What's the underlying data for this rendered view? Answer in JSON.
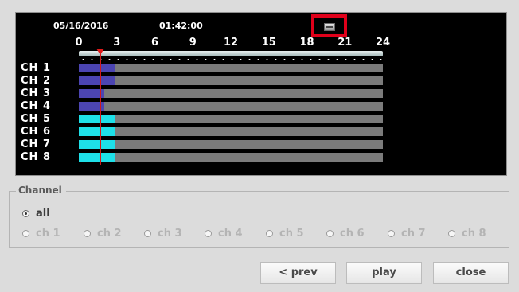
{
  "timeline": {
    "date": "05/16/2016",
    "time": "01:42:00",
    "hour_ticks": [
      "0",
      "3",
      "6",
      "9",
      "12",
      "15",
      "18",
      "21",
      "24"
    ],
    "hours_total": 24,
    "cursor_hour": 1.7,
    "menu_icon": "menu-icon",
    "channels": [
      {
        "label": "CH 1",
        "recorded_until_hour": 2.8,
        "color": "#4c45b2"
      },
      {
        "label": "CH 2",
        "recorded_until_hour": 2.8,
        "color": "#4c45b2"
      },
      {
        "label": "CH 3",
        "recorded_until_hour": 2.0,
        "color": "#4c45b2"
      },
      {
        "label": "CH 4",
        "recorded_until_hour": 2.0,
        "color": "#4c45b2"
      },
      {
        "label": "CH 5",
        "recorded_until_hour": 2.8,
        "color": "#1ee0e8"
      },
      {
        "label": "CH 6",
        "recorded_until_hour": 2.8,
        "color": "#1ee0e8"
      },
      {
        "label": "CH 7",
        "recorded_until_hour": 2.8,
        "color": "#1ee0e8"
      },
      {
        "label": "CH 8",
        "recorded_until_hour": 2.8,
        "color": "#1ee0e8"
      }
    ],
    "colors": {
      "background": "#000000",
      "track": "#7b7b7b",
      "cursor": "#d21a1a",
      "highlight": "#e0001a"
    }
  },
  "channel_group": {
    "legend": "Channel",
    "options": [
      {
        "label": "all",
        "selected": true
      },
      {
        "label": "ch 1",
        "selected": false
      },
      {
        "label": "ch 2",
        "selected": false
      },
      {
        "label": "ch 3",
        "selected": false
      },
      {
        "label": "ch 4",
        "selected": false
      },
      {
        "label": "ch 5",
        "selected": false
      },
      {
        "label": "ch 6",
        "selected": false
      },
      {
        "label": "ch 7",
        "selected": false
      },
      {
        "label": "ch 8",
        "selected": false
      }
    ]
  },
  "buttons": {
    "prev": "< prev",
    "play": "play",
    "close": "close"
  }
}
